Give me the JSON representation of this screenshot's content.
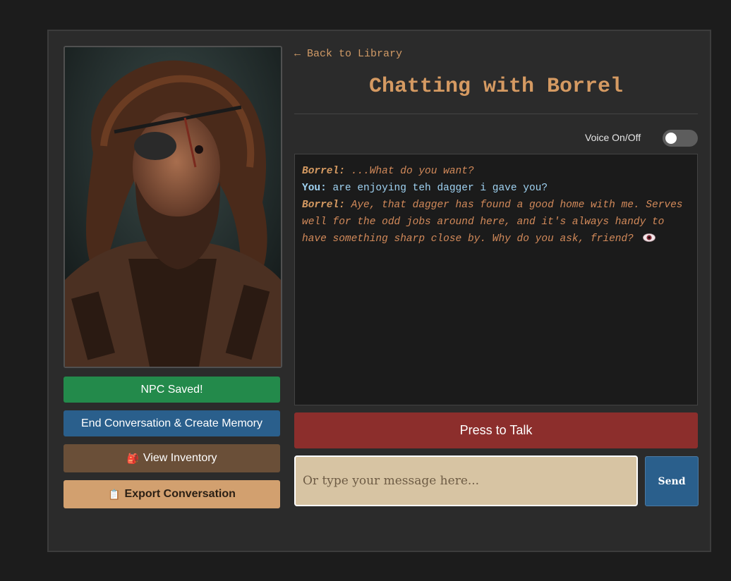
{
  "nav": {
    "back_label": "← Back to Library"
  },
  "header": {
    "title": "Chatting with Borrel"
  },
  "voice": {
    "label": "Voice On/Off",
    "enabled": false
  },
  "actions": {
    "saved_label": "NPC Saved!",
    "memory_label": "End Conversation & Create Memory",
    "inventory_icon": "🎒",
    "inventory_label": "View Inventory",
    "export_icon": "📋",
    "export_label": "Export Conversation"
  },
  "chat": {
    "messages": [
      {
        "speaker": "Borrel:",
        "text": "...What do you want?"
      },
      {
        "speaker": "You:",
        "text": "are enjoying teh dagger i gave you?"
      },
      {
        "speaker": "Borrel:",
        "text": "Aye, that dagger has found a good home with me. Serves well for the odd jobs around here, and it's always handy to have something sharp close by. Why do you ask, friend?"
      }
    ]
  },
  "controls": {
    "talk_label": "Press to Talk",
    "input_placeholder": "Or type your message here...",
    "input_value": "",
    "send_label": "Send"
  },
  "colors": {
    "accent": "#d59a62",
    "saved": "#238a4b",
    "memory": "#2a5f8c",
    "inventory": "#6a4f38",
    "export": "#d2a06f",
    "talk": "#8c2e2c"
  }
}
